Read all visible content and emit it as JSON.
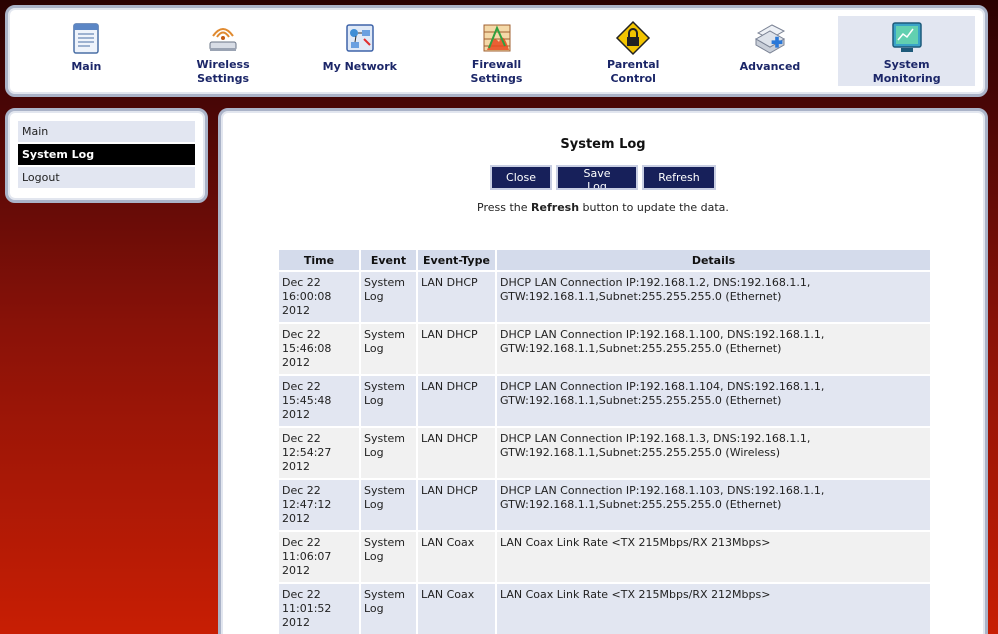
{
  "nav": {
    "items": [
      {
        "label": "Main",
        "icon": "main-page-icon"
      },
      {
        "label": "Wireless\nSettings",
        "icon": "wireless-router-icon"
      },
      {
        "label": "My Network",
        "icon": "my-network-icon"
      },
      {
        "label": "Firewall\nSettings",
        "icon": "firewall-icon"
      },
      {
        "label": "Parental\nControl",
        "icon": "parental-control-lock-icon"
      },
      {
        "label": "Advanced",
        "icon": "advanced-scanner-icon"
      },
      {
        "label": "System\nMonitoring",
        "icon": "system-monitoring-icon"
      }
    ],
    "active_index": 6
  },
  "sidebar": {
    "items": [
      {
        "label": "Main"
      },
      {
        "label": "System Log"
      },
      {
        "label": "Logout"
      }
    ],
    "selected_index": 1
  },
  "main": {
    "title": "System Log",
    "buttons": {
      "close": "Close",
      "save": "Save Log",
      "refresh": "Refresh"
    },
    "hint_pre": "Press the ",
    "hint_bold": "Refresh",
    "hint_post": " button to update the data."
  },
  "log_table": {
    "headers": {
      "time": "Time",
      "event": "Event",
      "event_type": "Event-Type",
      "details": "Details"
    },
    "rows": [
      {
        "time1": "Dec 22",
        "time2": "16:00:08",
        "time3": "2012",
        "event1": "System",
        "event2": "Log",
        "type": "LAN DHCP",
        "details1": "DHCP LAN Connection IP:192.168.1.2, DNS:192.168.1.1,",
        "details2": "GTW:192.168.1.1,Subnet:255.255.255.0 (Ethernet)"
      },
      {
        "time1": "Dec 22",
        "time2": "15:46:08",
        "time3": "2012",
        "event1": "System",
        "event2": "Log",
        "type": "LAN DHCP",
        "details1": "DHCP LAN Connection IP:192.168.1.100, DNS:192.168.1.1,",
        "details2": "GTW:192.168.1.1,Subnet:255.255.255.0 (Ethernet)"
      },
      {
        "time1": "Dec 22",
        "time2": "15:45:48",
        "time3": "2012",
        "event1": "System",
        "event2": "Log",
        "type": "LAN DHCP",
        "details1": "DHCP LAN Connection IP:192.168.1.104, DNS:192.168.1.1,",
        "details2": "GTW:192.168.1.1,Subnet:255.255.255.0 (Ethernet)"
      },
      {
        "time1": "Dec 22",
        "time2": "12:54:27",
        "time3": "2012",
        "event1": "System",
        "event2": "Log",
        "type": "LAN DHCP",
        "details1": "DHCP LAN Connection IP:192.168.1.3, DNS:192.168.1.1,",
        "details2": "GTW:192.168.1.1,Subnet:255.255.255.0 (Wireless)"
      },
      {
        "time1": "Dec 22",
        "time2": "12:47:12",
        "time3": "2012",
        "event1": "System",
        "event2": "Log",
        "type": "LAN DHCP",
        "details1": "DHCP LAN Connection IP:192.168.1.103, DNS:192.168.1.1,",
        "details2": "GTW:192.168.1.1,Subnet:255.255.255.0 (Ethernet)"
      },
      {
        "time1": "Dec 22",
        "time2": "11:06:07",
        "time3": "2012",
        "event1": "System",
        "event2": "Log",
        "type": "LAN Coax",
        "details1": "LAN Coax Link Rate <TX 215Mbps/RX 213Mbps>",
        "details2": ""
      },
      {
        "time1": "Dec 22",
        "time2": "11:01:52",
        "time3": "2012",
        "event1": "System",
        "event2": "Log",
        "type": "LAN Coax",
        "details1": "LAN Coax Link Rate <TX 215Mbps/RX 212Mbps>",
        "details2": ""
      }
    ]
  }
}
